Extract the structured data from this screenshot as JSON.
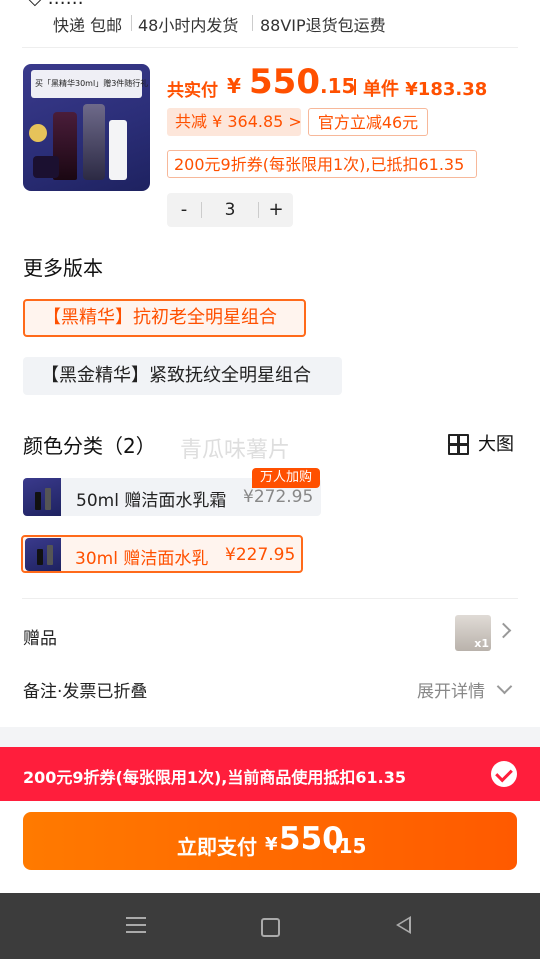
{
  "shipping": {
    "top_clipped": "◇  ……",
    "items": [
      "快递 包邮",
      "48小时内发货",
      "88VIP退货包运费"
    ]
  },
  "product": {
    "image_banner": "买「黑精华30ml」赠3件随行礼",
    "price_label": "共实付",
    "currency": "¥",
    "price_int": "550",
    "price_dec": ".15",
    "unit_price": "单件 ¥183.38",
    "total_saving": "共减 ¥ 364.85 >",
    "official_off": "官方立减46元",
    "coupon_note": "200元9折券(每张限用1次),已抵扣61.35",
    "qty_minus": "-",
    "qty": "3",
    "qty_plus": "+"
  },
  "versions": {
    "title": "更多版本",
    "options": [
      "【黑精华】抗初老全明星组合",
      "【黑金精华】紧致抚纹全明星组合"
    ],
    "selected_index": 0
  },
  "colors": {
    "title": "颜色分类（2）",
    "big_view": "大图",
    "watermark": "青瓜味薯片",
    "options": [
      {
        "name": "50ml 赠洁面水乳霜",
        "price": "¥272.95",
        "badge": "万人加购"
      },
      {
        "name": "30ml 赠洁面水乳",
        "price": "¥227.95"
      }
    ],
    "selected_index": 1
  },
  "extras": {
    "gift_label": "赠品",
    "gift_count": "x1",
    "note_label": "备注·发票已折叠",
    "expand_label": "展开详情"
  },
  "coupon_bar": {
    "text": "200元9折券(每张限用1次),当前商品使用抵扣61.35",
    "checked": true
  },
  "pay": {
    "label": "立即支付",
    "currency": "¥",
    "price_int": "550",
    "price_dec": ".15"
  },
  "colors_palette": {
    "accent": "#ff5000",
    "coupon_red": "#ff1e3c",
    "nav_bg": "#3c3c3c"
  },
  "navbar": {
    "icons": [
      "menu-icon",
      "home-icon",
      "back-icon"
    ]
  }
}
